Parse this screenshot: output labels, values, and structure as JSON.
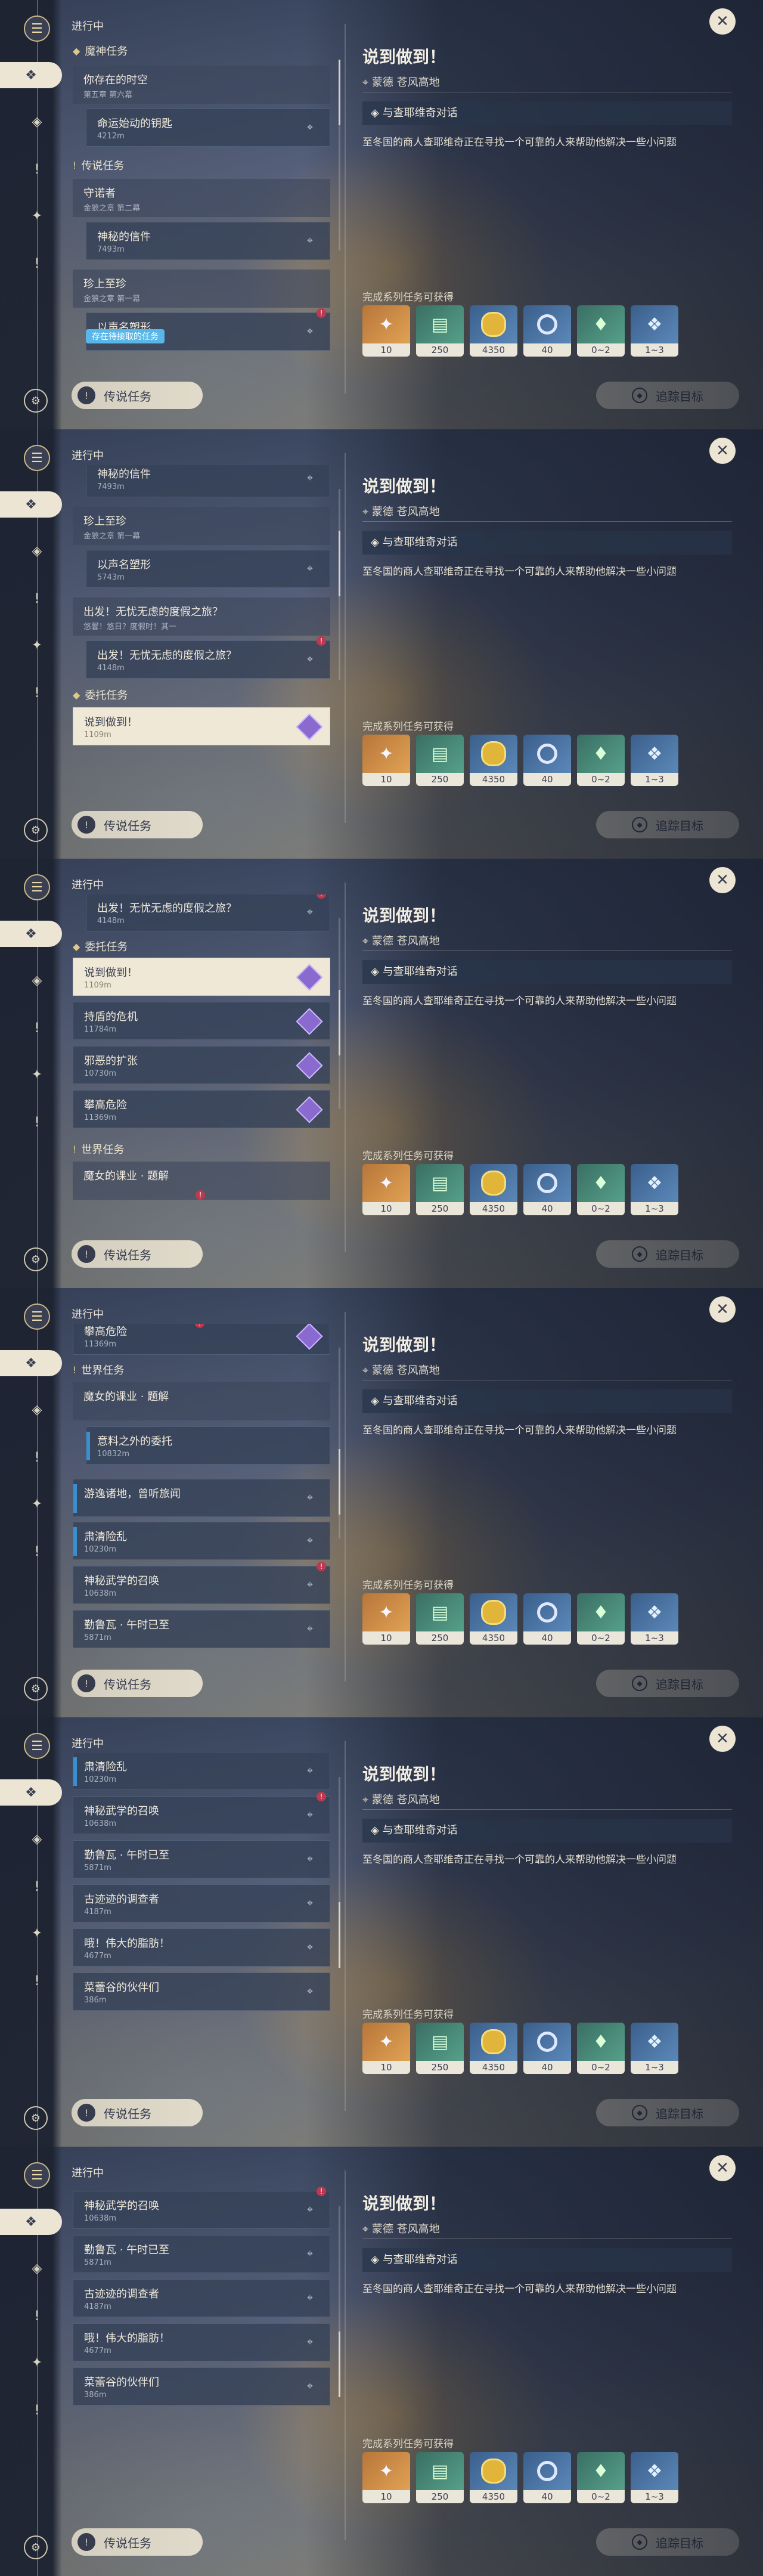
{
  "labels": {
    "status": "进行中",
    "legend_button": "传说任务",
    "track_button": "追踪目标",
    "pending_hint": "存在待接取的任务",
    "rewards_label": "完成系列任务可获得"
  },
  "detail": {
    "title": "说到做到！",
    "location": "蒙德 苍风高地",
    "objective": "与查耶维奇对话",
    "description": "至冬国的商人查耶维奇正在寻找一个可靠的人来帮助他解决一些小问题"
  },
  "rewards": [
    {
      "icon": "primogem-icon",
      "count": "10"
    },
    {
      "icon": "adventure-exp-icon",
      "count": "250"
    },
    {
      "icon": "mora-icon",
      "count": "4350"
    },
    {
      "icon": "companionship-exp-icon",
      "count": "40"
    },
    {
      "icon": "crystal-icon",
      "count": "0~2"
    },
    {
      "icon": "crystal-chunk-icon",
      "count": "1~3"
    }
  ],
  "quests": {
    "archon_category": "魔神任务",
    "archon_1_title": "你存在的时空",
    "archon_1_sub": "第五章 第六幕",
    "archon_1a_title": "命运始动的钥匙",
    "archon_1a_dist": "4212m",
    "legend_category": "传说任务",
    "legend_1_title": "守诺者",
    "legend_1_sub": "金狼之章 第二幕",
    "legend_1a_title": "神秘的信件",
    "legend_1a_dist": "7493m",
    "legend_2_title": "珍上至珍",
    "legend_2_sub": "金狼之章 第一幕",
    "legend_2a_title": "以声名塑形",
    "legend_2a_dist": "5743m",
    "legend_3_title": "出发！无忧无虑的度假之旅？",
    "legend_3_sub": "悠馨！悠日？度假时！其一",
    "legend_3a_title": "出发！无忧无虑的度假之旅？",
    "legend_3a_dist": "4148m",
    "commission_category": "委托任务",
    "commission_1_title": "说到做到！",
    "commission_1_dist": "1109m",
    "commission_2_title": "持盾的危机",
    "commission_2_dist": "11784m",
    "commission_3_title": "邪恶的扩张",
    "commission_3_dist": "10730m",
    "commission_4_title": "攀高危险",
    "commission_4_dist": "11369m",
    "world_category": "世界任务",
    "world_1_title": "魔女的课业 · 题解",
    "world_1a_title": "意料之外的委托",
    "world_1a_dist": "10832m",
    "world_2_title": "游逸诸地，曾听旅闻",
    "world_3_title": "肃清险乱",
    "world_3_dist": "10230m",
    "world_4_title": "神秘武学的召唤",
    "world_4_dist": "10638m",
    "world_5_title": "勤鲁瓦 · 午时已至",
    "world_5_dist": "5871m",
    "world_6_title": "古迹迹的调查者",
    "world_6_dist": "4187m",
    "world_7_title": "哦！伟大的脂肪！",
    "world_7_dist": "4677m",
    "world_8_title": "菜蕾谷的伙伴们",
    "world_8_dist": "386m"
  },
  "nav_icons": [
    "quest-book-icon",
    "diamond-icon",
    "compass-icon",
    "exclamation-icon",
    "star-icon",
    "exclamation-icon",
    "settings-icon"
  ]
}
